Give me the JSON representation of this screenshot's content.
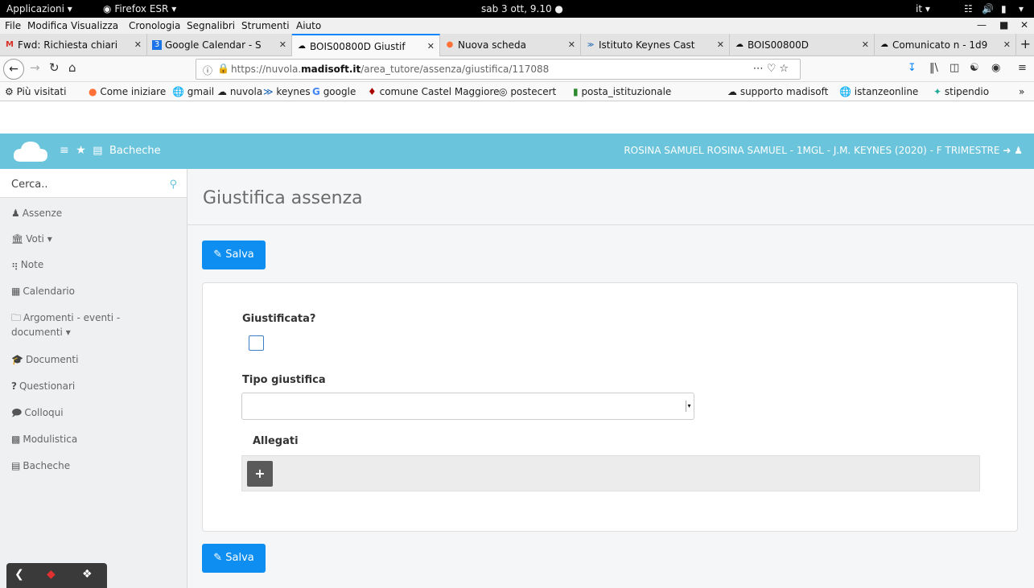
{
  "system_bar": {
    "applications": "Applicazioni ▾",
    "firefox_app": "Firefox ESR ▾",
    "clock": "sab 3 ott, 9.10 ●",
    "lang": "it ▾"
  },
  "menubar": {
    "file": "File",
    "modifica": "Modifica",
    "visualizza": "Visualizza",
    "cronologia": "Cronologia",
    "segnalibri": "Segnalibri",
    "strumenti": "Strumenti",
    "aiuto": "Aiuto"
  },
  "tabs": [
    {
      "label": "Fwd: Richiesta chiari",
      "icon": "gmail-icon"
    },
    {
      "label": "Google Calendar - S",
      "icon": "calendar-icon"
    },
    {
      "label": "BOIS00800D Giustif",
      "icon": "cloud-icon",
      "active": true
    },
    {
      "label": "Nuova scheda",
      "icon": "firefox-icon"
    },
    {
      "label": "Istituto Keynes Cast",
      "icon": "keynes-icon"
    },
    {
      "label": "BOIS00800D",
      "icon": "cloud-icon"
    },
    {
      "label": "Comunicato n - 1d9",
      "icon": "cloud-icon"
    }
  ],
  "url": {
    "prefix": "https://nuvola.",
    "domain": "madisoft.it",
    "path": "/area_tutore/assenza/giustifica/117088"
  },
  "bookmarks": [
    "Più visitati",
    "Come iniziare",
    "gmail",
    "nuvola",
    "keynes",
    "google",
    "comune Castel Maggiore",
    "postecert",
    "posta_istituzionale",
    "supporto madisoft",
    "istanzeonline",
    "stipendio"
  ],
  "header": {
    "menu_label": "Bacheche",
    "user": "ROSINA SAMUEL  ROSINA SAMUEL - 1MGL - J.M. KEYNES (2020) - F  TRIMESTRE"
  },
  "sidebar": {
    "search_placeholder": "Cerca..",
    "items": [
      {
        "label": "Assenze",
        "icon": "user-icon"
      },
      {
        "label": "Voti ▾",
        "icon": "bank-icon"
      },
      {
        "label": "Note",
        "icon": "pin-icon"
      },
      {
        "label": "Calendario",
        "icon": "calendar-icon"
      },
      {
        "label": "Argomenti - eventi -",
        "label2": "documenti ▾",
        "icon": "folder-icon"
      },
      {
        "label": "Documenti",
        "icon": "graduation-icon"
      },
      {
        "label": "Questionari",
        "icon": "question-icon"
      },
      {
        "label": "Colloqui",
        "icon": "chat-icon"
      },
      {
        "label": "Modulistica",
        "icon": "building-icon"
      },
      {
        "label": "Bacheche",
        "icon": "board-icon"
      }
    ]
  },
  "main": {
    "title": "Giustifica assenza",
    "save_label": "Salva",
    "giustificata_label": "Giustificata?",
    "tipo_label": "Tipo giustifica",
    "allegati_label": "Allegati",
    "add_label": "+"
  },
  "colors": {
    "header": "#6ac4dc",
    "button": "#0d8ef0",
    "accent_tab": "#0a84ff"
  }
}
